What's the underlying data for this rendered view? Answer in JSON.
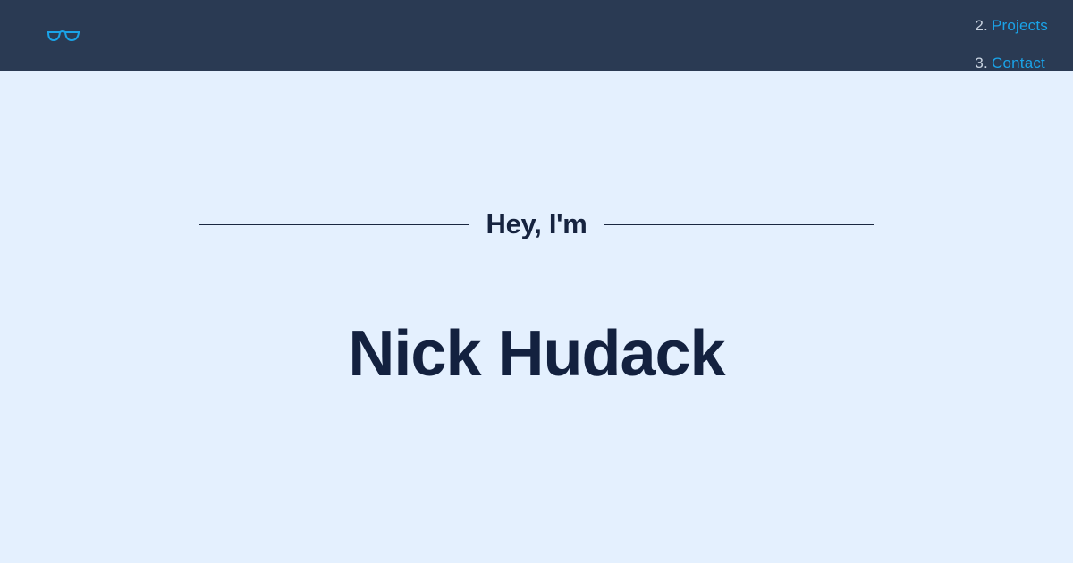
{
  "colors": {
    "header_bg": "#2a3a53",
    "page_bg": "#e4f0fe",
    "accent": "#1aa3e8",
    "text_dark": "#13213f"
  },
  "header": {
    "logo_icon": "glasses-icon",
    "nav": [
      {
        "number": "2.",
        "label": "Projects"
      },
      {
        "number": "3.",
        "label": "Contact"
      }
    ]
  },
  "hero": {
    "greeting": "Hey, I'm",
    "name": "Nick Hudack"
  }
}
